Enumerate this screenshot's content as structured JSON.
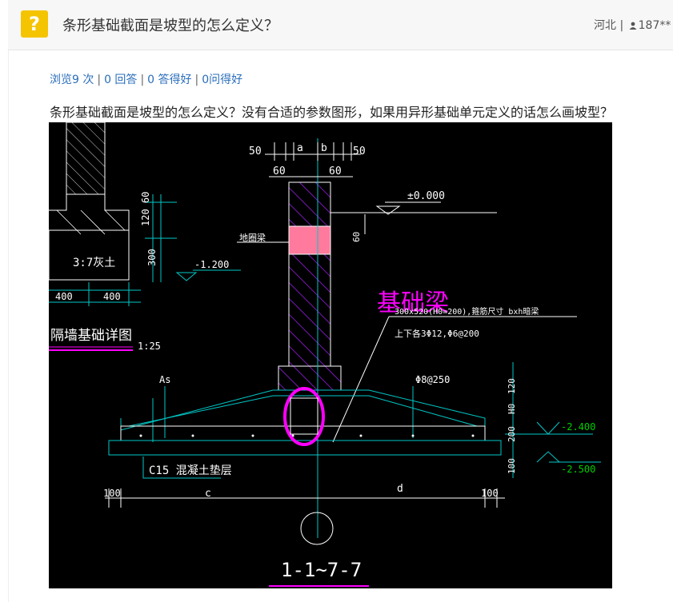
{
  "header": {
    "icon_glyph": "?",
    "title": "条形基础截面是坡型的怎么定义？",
    "location": "河北",
    "separator": "|",
    "user": "187**"
  },
  "stats": {
    "views": "浏览9 次",
    "answers": "0 回答",
    "good_answers": "0 答得好",
    "question_good": "0问得好",
    "sep": "|"
  },
  "question_body": "条形基础截面是坡型的怎么定义？没有合适的参数图形，如果用异形基础单元定义的话怎么画坡型？",
  "drawing": {
    "annotation_red": "基础梁",
    "dim_top": [
      "50",
      "a",
      "b",
      "50"
    ],
    "dim_60_left": "60",
    "dim_60_right": "60",
    "level_0": "±0.000",
    "dim_60_side": "60",
    "ring_beam_label": "地圈梁",
    "dim_120_60": "120 60",
    "dim_300": "300",
    "level_neg_1200": "-1.200",
    "soil_label": "3:7灰土",
    "dim_400_a": "400",
    "dim_400_b": "400",
    "wall_detail_title": "隔墙基础详图",
    "scale": "1:25",
    "beam_note_1": "300x520(H0=200),箍筋尺寸 bxh暗梁",
    "beam_note_2": "上下各3Φ12,Φ6@200",
    "as_label": "As",
    "stirrup_label": "Φ8@250",
    "dim_120": "120",
    "h0_label": "H0",
    "level_neg_2400": "-2.400",
    "dim_200": "200",
    "dim_100": "100",
    "level_neg_2500": "-2.500",
    "concrete_label": "C15 混凝土垫层",
    "dim_100_left": "100",
    "dim_c": "c",
    "dim_d": "d",
    "dim_100_right": "100",
    "section_title": "1-1~7-7",
    "colors": {
      "background": "#000000",
      "cyan": "#00c8c8",
      "magenta": "#ff00ff",
      "white": "#ffffff",
      "pink_fill": "#ff7a9c",
      "green": "#00d000",
      "purple": "#a020f0"
    }
  }
}
